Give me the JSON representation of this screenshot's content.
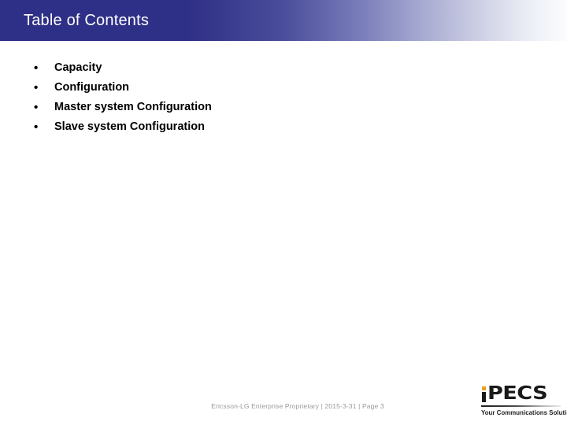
{
  "slide": {
    "header": {
      "title": "Table of Contents",
      "gradient_start_color": "#2e2f86",
      "gradient_mid_color": "#7b7fba",
      "gradient_end_color": "#fcfcfe",
      "title_color": "#ffffff"
    },
    "toc": {
      "bullet_glyph": "•",
      "items": [
        {
          "label": "Capacity"
        },
        {
          "label": "Configuration"
        },
        {
          "label": "Master system Configuration"
        },
        {
          "label": "Slave system Configuration"
        }
      ]
    },
    "footer": {
      "note": "Ericsson-LG Enterprise Proprietary | 2015-3-31 | Page 3",
      "note_color": "#9a9a9a"
    },
    "logo": {
      "mark_i": "i",
      "mark_rest": "PECS",
      "tagline": "Your Communications Solution",
      "dot_color": "#e8a020",
      "text_color": "#1a1a1a"
    }
  }
}
